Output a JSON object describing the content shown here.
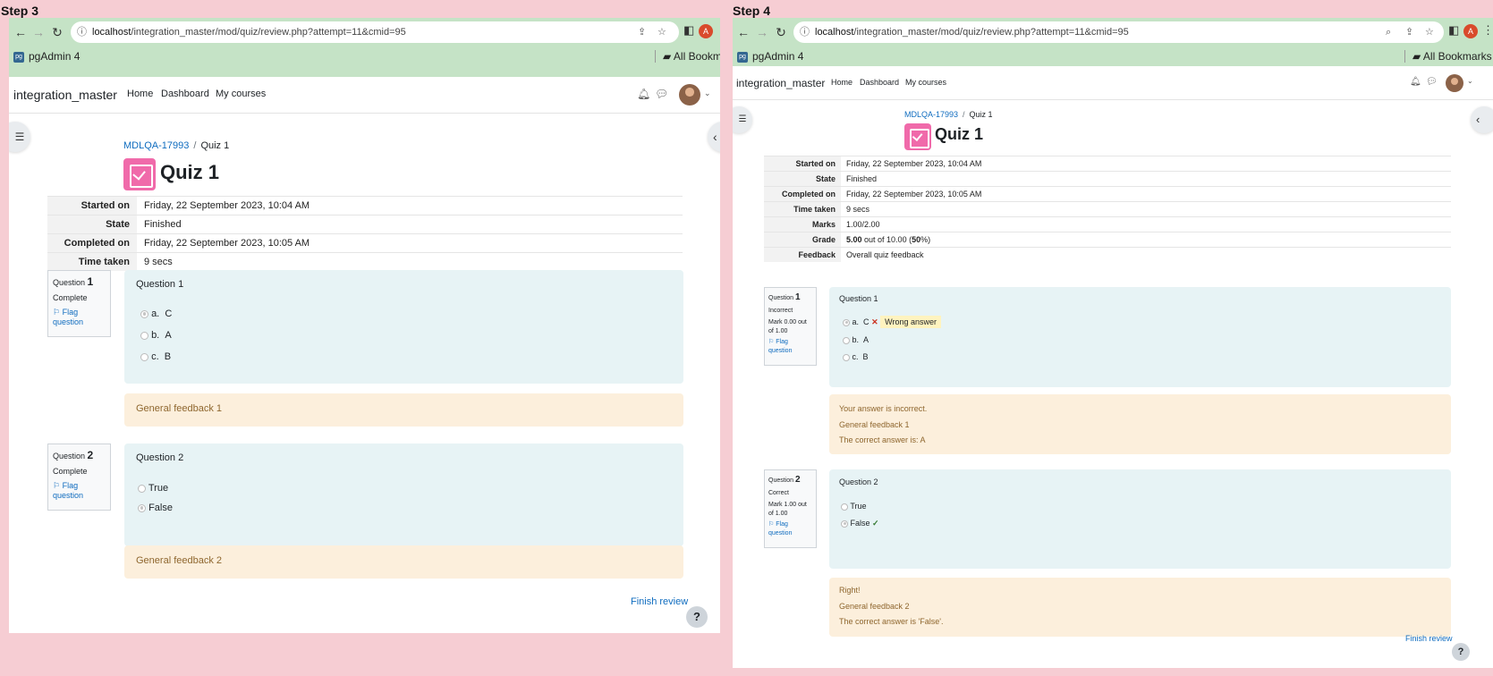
{
  "left": {
    "step_label": "Step 3",
    "browser": {
      "url_host": "localhost",
      "url_path": "/integration_master/mod/quiz/review.php?attempt=11&cmid=95",
      "bookmark": "pgAdmin 4",
      "all_bookmarks": "All Bookmar",
      "profile_initial": "A"
    },
    "moodle": {
      "site_name": "integration_master",
      "nav": [
        "Home",
        "Dashboard",
        "My courses"
      ],
      "breadcrumb_course": "MDLQA-17993",
      "breadcrumb_current": "Quiz 1",
      "quiz_title": "Quiz 1",
      "summary": [
        {
          "k": "Started on",
          "v": "Friday, 22 September 2023, 10:04 AM"
        },
        {
          "k": "State",
          "v": "Finished"
        },
        {
          "k": "Completed on",
          "v": "Friday, 22 September 2023, 10:05 AM"
        },
        {
          "k": "Time taken",
          "v": "9 secs"
        }
      ],
      "questions": [
        {
          "label": "Question",
          "number": "1",
          "status": "Complete",
          "flag": "Flag question",
          "text": "Question 1",
          "options": [
            {
              "letter": "a.",
              "text": "C",
              "selected": true
            },
            {
              "letter": "b.",
              "text": "A",
              "selected": false
            },
            {
              "letter": "c.",
              "text": "B",
              "selected": false
            }
          ],
          "feedback": [
            "General feedback 1"
          ]
        },
        {
          "label": "Question",
          "number": "2",
          "status": "Complete",
          "flag": "Flag question",
          "text": "Question 2",
          "options": [
            {
              "letter": "",
              "text": "True",
              "selected": false
            },
            {
              "letter": "",
              "text": "False",
              "selected": true
            }
          ],
          "feedback": [
            "General feedback 2"
          ]
        }
      ],
      "finish_review": "Finish review",
      "help": "?"
    }
  },
  "right": {
    "step_label": "Step 4",
    "browser": {
      "url_host": "localhost",
      "url_path": "/integration_master/mod/quiz/review.php?attempt=11&cmid=95",
      "bookmark": "pgAdmin 4",
      "all_bookmarks": "All Bookmarks",
      "profile_initial": "A"
    },
    "moodle": {
      "site_name": "integration_master",
      "nav": [
        "Home",
        "Dashboard",
        "My courses"
      ],
      "breadcrumb_course": "MDLQA-17993",
      "breadcrumb_current": "Quiz 1",
      "quiz_title": "Quiz 1",
      "summary": [
        {
          "k": "Started on",
          "v": "Friday, 22 September 2023, 10:04 AM"
        },
        {
          "k": "State",
          "v": "Finished"
        },
        {
          "k": "Completed on",
          "v": "Friday, 22 September 2023, 10:05 AM"
        },
        {
          "k": "Time taken",
          "v": "9 secs"
        },
        {
          "k": "Marks",
          "v": "1.00/2.00"
        },
        {
          "k": "Grade",
          "v_bold1": "5.00",
          "v_mid": " out of 10.00 (",
          "v_bold2": "50",
          "v_end": "%)"
        },
        {
          "k": "Feedback",
          "v": "Overall quiz feedback"
        }
      ],
      "questions": [
        {
          "label": "Question",
          "number": "1",
          "status": "Incorrect",
          "mark": "Mark 0.00 out of 1.00",
          "flag": "Flag question",
          "text": "Question 1",
          "options": [
            {
              "letter": "a.",
              "text": "C",
              "selected": true,
              "mark": "✕",
              "badge": "Wrong answer"
            },
            {
              "letter": "b.",
              "text": "A",
              "selected": false
            },
            {
              "letter": "c.",
              "text": "B",
              "selected": false
            }
          ],
          "feedback": [
            "Your answer is incorrect.",
            "General feedback 1",
            "The correct answer is: A"
          ]
        },
        {
          "label": "Question",
          "number": "2",
          "status": "Correct",
          "mark": "Mark 1.00 out of 1.00",
          "flag": "Flag question",
          "text": "Question 2",
          "options": [
            {
              "letter": "",
              "text": "True",
              "selected": false
            },
            {
              "letter": "",
              "text": "False",
              "selected": true,
              "mark": "✓"
            }
          ],
          "feedback": [
            "Right!",
            "General feedback 2",
            "The correct answer is 'False'."
          ]
        }
      ],
      "finish_review": "Finish review",
      "help": "?"
    }
  },
  "colors": {
    "background": "#f6cdd3",
    "browser_chrome": "#c5e3c6",
    "link": "#0f6cbf",
    "quiz_icon": "#f06aaa",
    "question_box": "#e7f3f5",
    "feedback_box": "#fcefdc",
    "feedback_text": "#8e662e",
    "wrong": "#ca3120",
    "right": "#357a32"
  }
}
